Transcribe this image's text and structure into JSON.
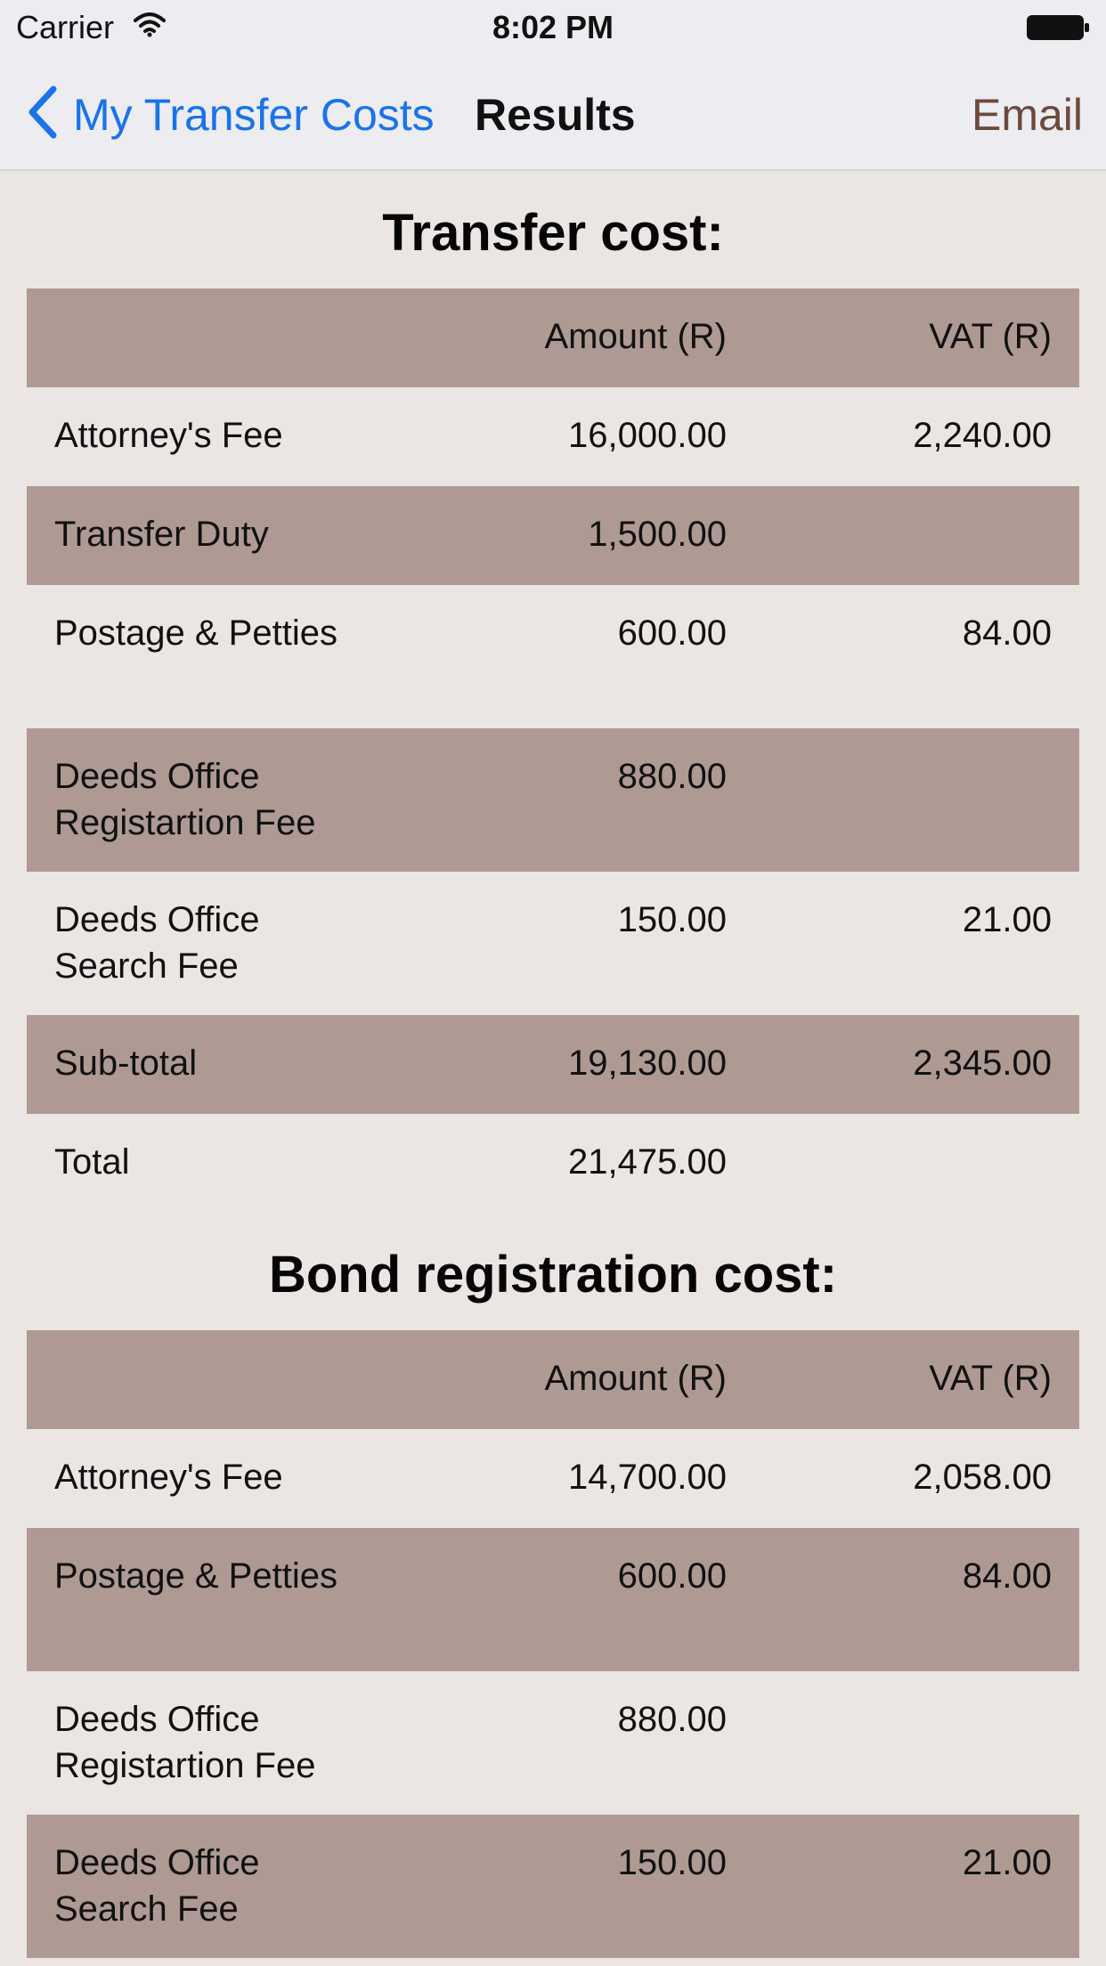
{
  "status_bar": {
    "carrier": "Carrier",
    "time": "8:02 PM"
  },
  "nav": {
    "back_label": "My Transfer Costs",
    "title": "Results",
    "email_label": "Email"
  },
  "colors": {
    "accent_blue": "#1a73e8",
    "email_brown": "#6b4a3c",
    "row_shaded": "#ae9a93",
    "background": "#ebe6e4"
  },
  "transfer": {
    "title": "Transfer cost:",
    "header": {
      "label": "",
      "amount": "Amount (R)",
      "vat": "VAT (R)"
    },
    "rows": [
      {
        "label": "Attorney's Fee",
        "amount": "16,000.00",
        "vat": "2,240.00"
      },
      {
        "label": "Transfer Duty",
        "amount": "1,500.00",
        "vat": ""
      },
      {
        "label": "Postage & Petties",
        "amount": "600.00",
        "vat": "84.00"
      },
      {
        "label": "Deeds Office Registartion Fee",
        "amount": "880.00",
        "vat": ""
      },
      {
        "label": "Deeds Office Search Fee",
        "amount": "150.00",
        "vat": "21.00"
      },
      {
        "label": "Sub-total",
        "amount": "19,130.00",
        "vat": "2,345.00"
      },
      {
        "label": "Total",
        "amount": "21,475.00",
        "vat": ""
      }
    ]
  },
  "bond": {
    "title": "Bond registration cost:",
    "header": {
      "label": "",
      "amount": "Amount (R)",
      "vat": "VAT (R)"
    },
    "rows": [
      {
        "label": "Attorney's Fee",
        "amount": "14,700.00",
        "vat": "2,058.00"
      },
      {
        "label": "Postage & Petties",
        "amount": "600.00",
        "vat": "84.00"
      },
      {
        "label": "Deeds Office Registartion Fee",
        "amount": "880.00",
        "vat": ""
      },
      {
        "label": "Deeds Office Search Fee",
        "amount": "150.00",
        "vat": "21.00"
      }
    ]
  }
}
